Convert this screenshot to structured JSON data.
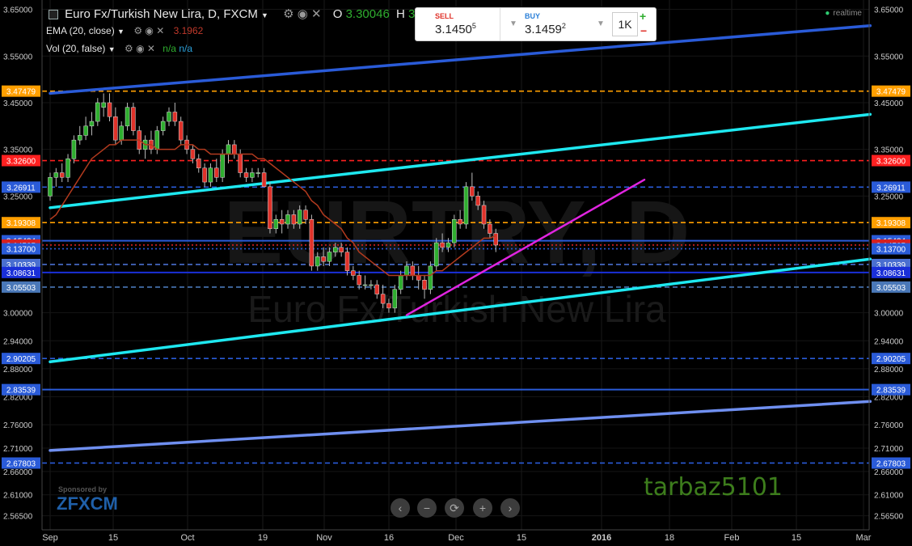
{
  "header": {
    "title": "Euro Fx/Turkish New Lira, D, FXCM",
    "ohlc_open_label": "O",
    "ohlc_open": "3.30046",
    "ohlc_high_label": "H",
    "ohlc_high": "3.344",
    "ema_label": "EMA (20, close)",
    "ema_value": "3.1962",
    "vol_label": "Vol (20, false)",
    "vol_value1": "n/a",
    "vol_value2": "n/a",
    "realtime": "realtime"
  },
  "trade_panel": {
    "sell_label": "SELL",
    "sell_price": "3.1450",
    "sell_pip": "5",
    "buy_label": "BUY",
    "buy_price": "3.1459",
    "buy_pip": "2",
    "quantity": "1K",
    "plus": "+",
    "minus": "−"
  },
  "sponsor": {
    "label": "Sponsored by",
    "brand": "FXCM"
  },
  "watermark": "tarbaz5101",
  "background_watermark": {
    "symbol": "EURTRY, D",
    "name": "Euro Fx/Turkish New Lira"
  },
  "nav_buttons": [
    "‹",
    "−",
    "⟳",
    "+",
    "›"
  ],
  "colors": {
    "up": "#2fae2f",
    "down": "#e0322a",
    "ema": "#b23a1e",
    "cyan": "#1ee8f0",
    "blue": "#2a5bd8",
    "lightblue": "#6f8ff0",
    "magenta": "#e024e0",
    "orange": "#ff9f00",
    "red": "#ff2020"
  },
  "chart_data": {
    "type": "candlestick",
    "symbol": "EUR/TRY",
    "timeframe": "D",
    "ylim": [
      2.535,
      3.67
    ],
    "y_ticks": [
      "3.65000",
      "3.55000",
      "3.45000",
      "3.35000",
      "3.25000",
      "3.00000",
      "2.94000",
      "2.88000",
      "2.82000",
      "2.76000",
      "2.71000",
      "2.66000",
      "2.61000",
      "2.56500"
    ],
    "x_ticks": [
      "Sep",
      "15",
      "Oct",
      "19",
      "Nov",
      "16",
      "Dec",
      "15",
      "2016",
      "18",
      "Feb",
      "15",
      "Mar"
    ],
    "candles": [
      {
        "o": 3.25,
        "h": 3.3,
        "l": 3.24,
        "c": 3.29
      },
      {
        "o": 3.29,
        "h": 3.31,
        "l": 3.27,
        "c": 3.3
      },
      {
        "o": 3.3,
        "h": 3.32,
        "l": 3.28,
        "c": 3.29
      },
      {
        "o": 3.29,
        "h": 3.34,
        "l": 3.28,
        "c": 3.33
      },
      {
        "o": 3.33,
        "h": 3.38,
        "l": 3.32,
        "c": 3.37
      },
      {
        "o": 3.37,
        "h": 3.4,
        "l": 3.36,
        "c": 3.38
      },
      {
        "o": 3.38,
        "h": 3.42,
        "l": 3.37,
        "c": 3.4
      },
      {
        "o": 3.4,
        "h": 3.43,
        "l": 3.38,
        "c": 3.41
      },
      {
        "o": 3.41,
        "h": 3.46,
        "l": 3.4,
        "c": 3.45
      },
      {
        "o": 3.44,
        "h": 3.47,
        "l": 3.42,
        "c": 3.45
      },
      {
        "o": 3.45,
        "h": 3.47,
        "l": 3.41,
        "c": 3.42
      },
      {
        "o": 3.42,
        "h": 3.44,
        "l": 3.36,
        "c": 3.37
      },
      {
        "o": 3.37,
        "h": 3.41,
        "l": 3.36,
        "c": 3.4
      },
      {
        "o": 3.4,
        "h": 3.45,
        "l": 3.39,
        "c": 3.44
      },
      {
        "o": 3.44,
        "h": 3.45,
        "l": 3.38,
        "c": 3.39
      },
      {
        "o": 3.39,
        "h": 3.4,
        "l": 3.34,
        "c": 3.35
      },
      {
        "o": 3.35,
        "h": 3.38,
        "l": 3.33,
        "c": 3.37
      },
      {
        "o": 3.37,
        "h": 3.39,
        "l": 3.34,
        "c": 3.35
      },
      {
        "o": 3.35,
        "h": 3.4,
        "l": 3.34,
        "c": 3.39
      },
      {
        "o": 3.39,
        "h": 3.42,
        "l": 3.38,
        "c": 3.41
      },
      {
        "o": 3.41,
        "h": 3.44,
        "l": 3.4,
        "c": 3.43
      },
      {
        "o": 3.43,
        "h": 3.45,
        "l": 3.4,
        "c": 3.41
      },
      {
        "o": 3.41,
        "h": 3.42,
        "l": 3.36,
        "c": 3.37
      },
      {
        "o": 3.37,
        "h": 3.38,
        "l": 3.34,
        "c": 3.35
      },
      {
        "o": 3.35,
        "h": 3.36,
        "l": 3.32,
        "c": 3.33
      },
      {
        "o": 3.33,
        "h": 3.34,
        "l": 3.3,
        "c": 3.31
      },
      {
        "o": 3.31,
        "h": 3.32,
        "l": 3.27,
        "c": 3.28
      },
      {
        "o": 3.28,
        "h": 3.32,
        "l": 3.27,
        "c": 3.31
      },
      {
        "o": 3.31,
        "h": 3.33,
        "l": 3.28,
        "c": 3.29
      },
      {
        "o": 3.29,
        "h": 3.35,
        "l": 3.28,
        "c": 3.34
      },
      {
        "o": 3.34,
        "h": 3.37,
        "l": 3.32,
        "c": 3.36
      },
      {
        "o": 3.36,
        "h": 3.37,
        "l": 3.33,
        "c": 3.34
      },
      {
        "o": 3.34,
        "h": 3.35,
        "l": 3.29,
        "c": 3.3
      },
      {
        "o": 3.3,
        "h": 3.31,
        "l": 3.28,
        "c": 3.29
      },
      {
        "o": 3.29,
        "h": 3.31,
        "l": 3.28,
        "c": 3.3
      },
      {
        "o": 3.3,
        "h": 3.31,
        "l": 3.29,
        "c": 3.3
      },
      {
        "o": 3.3,
        "h": 3.31,
        "l": 3.27,
        "c": 3.27
      },
      {
        "o": 3.27,
        "h": 3.28,
        "l": 3.17,
        "c": 3.18
      },
      {
        "o": 3.18,
        "h": 3.21,
        "l": 3.17,
        "c": 3.2
      },
      {
        "o": 3.2,
        "h": 3.22,
        "l": 3.17,
        "c": 3.19
      },
      {
        "o": 3.19,
        "h": 3.22,
        "l": 3.18,
        "c": 3.21
      },
      {
        "o": 3.21,
        "h": 3.22,
        "l": 3.18,
        "c": 3.19
      },
      {
        "o": 3.19,
        "h": 3.23,
        "l": 3.18,
        "c": 3.22
      },
      {
        "o": 3.22,
        "h": 3.23,
        "l": 3.19,
        "c": 3.2
      },
      {
        "o": 3.2,
        "h": 3.21,
        "l": 3.09,
        "c": 3.1
      },
      {
        "o": 3.1,
        "h": 3.13,
        "l": 3.09,
        "c": 3.12
      },
      {
        "o": 3.12,
        "h": 3.14,
        "l": 3.1,
        "c": 3.11
      },
      {
        "o": 3.11,
        "h": 3.14,
        "l": 3.1,
        "c": 3.13
      },
      {
        "o": 3.13,
        "h": 3.15,
        "l": 3.12,
        "c": 3.14
      },
      {
        "o": 3.14,
        "h": 3.15,
        "l": 3.12,
        "c": 3.13
      },
      {
        "o": 3.13,
        "h": 3.14,
        "l": 3.08,
        "c": 3.09
      },
      {
        "o": 3.09,
        "h": 3.1,
        "l": 3.07,
        "c": 3.08
      },
      {
        "o": 3.08,
        "h": 3.09,
        "l": 3.05,
        "c": 3.06
      },
      {
        "o": 3.06,
        "h": 3.08,
        "l": 3.05,
        "c": 3.06
      },
      {
        "o": 3.06,
        "h": 3.07,
        "l": 3.05,
        "c": 3.06
      },
      {
        "o": 3.06,
        "h": 3.07,
        "l": 3.03,
        "c": 3.04
      },
      {
        "o": 3.04,
        "h": 3.06,
        "l": 3.01,
        "c": 3.02
      },
      {
        "o": 3.02,
        "h": 3.03,
        "l": 3.0,
        "c": 3.01
      },
      {
        "o": 3.01,
        "h": 3.06,
        "l": 3.0,
        "c": 3.05
      },
      {
        "o": 3.05,
        "h": 3.09,
        "l": 3.04,
        "c": 3.08
      },
      {
        "o": 3.08,
        "h": 3.11,
        "l": 3.07,
        "c": 3.1
      },
      {
        "o": 3.1,
        "h": 3.11,
        "l": 3.07,
        "c": 3.08
      },
      {
        "o": 3.08,
        "h": 3.1,
        "l": 3.05,
        "c": 3.07
      },
      {
        "o": 3.07,
        "h": 3.08,
        "l": 3.03,
        "c": 3.05
      },
      {
        "o": 3.05,
        "h": 3.11,
        "l": 3.04,
        "c": 3.1
      },
      {
        "o": 3.1,
        "h": 3.16,
        "l": 3.09,
        "c": 3.15
      },
      {
        "o": 3.15,
        "h": 3.17,
        "l": 3.13,
        "c": 3.14
      },
      {
        "o": 3.14,
        "h": 3.16,
        "l": 3.13,
        "c": 3.15
      },
      {
        "o": 3.15,
        "h": 3.21,
        "l": 3.14,
        "c": 3.2
      },
      {
        "o": 3.2,
        "h": 3.22,
        "l": 3.18,
        "c": 3.19
      },
      {
        "o": 3.19,
        "h": 3.28,
        "l": 3.18,
        "c": 3.27
      },
      {
        "o": 3.27,
        "h": 3.3,
        "l": 3.24,
        "c": 3.25
      },
      {
        "o": 3.25,
        "h": 3.26,
        "l": 3.22,
        "c": 3.23
      },
      {
        "o": 3.23,
        "h": 3.24,
        "l": 3.18,
        "c": 3.19
      },
      {
        "o": 3.19,
        "h": 3.2,
        "l": 3.16,
        "c": 3.17
      },
      {
        "o": 3.17,
        "h": 3.18,
        "l": 3.13,
        "c": 3.145
      }
    ],
    "ema20": [
      3.2,
      3.21,
      3.23,
      3.25,
      3.27,
      3.29,
      3.31,
      3.33,
      3.34,
      3.35,
      3.36,
      3.36,
      3.37,
      3.37,
      3.37,
      3.37,
      3.36,
      3.36,
      3.35,
      3.35,
      3.35,
      3.35,
      3.36,
      3.36,
      3.36,
      3.35,
      3.35,
      3.34,
      3.34,
      3.34,
      3.34,
      3.34,
      3.34,
      3.34,
      3.34,
      3.33,
      3.33,
      3.32,
      3.31,
      3.3,
      3.29,
      3.28,
      3.27,
      3.26,
      3.24,
      3.23,
      3.21,
      3.2,
      3.19,
      3.18,
      3.16,
      3.15,
      3.13,
      3.12,
      3.11,
      3.1,
      3.09,
      3.08,
      3.08,
      3.08,
      3.08,
      3.08,
      3.08,
      3.08,
      3.08,
      3.09,
      3.09,
      3.1,
      3.11,
      3.12,
      3.13,
      3.14,
      3.15,
      3.16,
      3.16,
      3.165
    ],
    "price_lines": [
      {
        "label": "3.47479",
        "color": "#ff9f00",
        "style": "dashed",
        "value": 3.47479
      },
      {
        "label": "3.32600",
        "color": "#ff2020",
        "style": "dashed",
        "value": 3.326
      },
      {
        "label": "3.26911",
        "color": "#2a5bd8",
        "style": "dashed",
        "value": 3.26911
      },
      {
        "label": "3.19308",
        "color": "#ff9f00",
        "style": "dashed",
        "value": 3.19308
      },
      {
        "label": "3.15434",
        "color": "#2a5bd8",
        "style": "solid",
        "value": 3.15434
      },
      {
        "label": "3.14505",
        "color": "#d62020",
        "style": "dotted",
        "value": 3.14505
      },
      {
        "label": "3.13700",
        "color": "#2a5bd8",
        "style": "dotted",
        "value": 3.137
      },
      {
        "label": "3.10339",
        "color": "#4a6fd0",
        "style": "dashed",
        "value": 3.10339
      },
      {
        "label": "3.08631",
        "color": "#1a2fd8",
        "style": "solid",
        "value": 3.08631
      },
      {
        "label": "3.05503",
        "color": "#4a78b8",
        "style": "dashed",
        "value": 3.05503
      },
      {
        "label": "2.90205",
        "color": "#2a5bd8",
        "style": "dashed",
        "value": 2.90205
      },
      {
        "label": "2.83539",
        "color": "#2a5bd8",
        "style": "solid",
        "value": 2.83539
      },
      {
        "label": "2.67803",
        "color": "#2a5bd8",
        "style": "dashed",
        "value": 2.67803
      }
    ],
    "trend_lines": [
      {
        "name": "upper-channel",
        "color": "#2a5bd8",
        "from": {
          "bar": 0,
          "value": 3.47
        },
        "to": {
          "bar": 138,
          "value": 3.615
        }
      },
      {
        "name": "mid-channel",
        "color": "#1ee8f0",
        "from": {
          "bar": 0,
          "value": 3.225
        },
        "to": {
          "bar": 138,
          "value": 3.425
        }
      },
      {
        "name": "lower-channel",
        "color": "#1ee8f0",
        "from": {
          "bar": 0,
          "value": 2.895
        },
        "to": {
          "bar": 138,
          "value": 3.115
        }
      },
      {
        "name": "bottom-channel",
        "color": "#6f8ff0",
        "from": {
          "bar": 0,
          "value": 2.705
        },
        "to": {
          "bar": 138,
          "value": 2.81
        }
      },
      {
        "name": "support-line",
        "color": "#e024e0",
        "from": {
          "bar": 60,
          "value": 2.995
        },
        "to": {
          "bar": 100,
          "value": 3.285
        }
      }
    ]
  }
}
